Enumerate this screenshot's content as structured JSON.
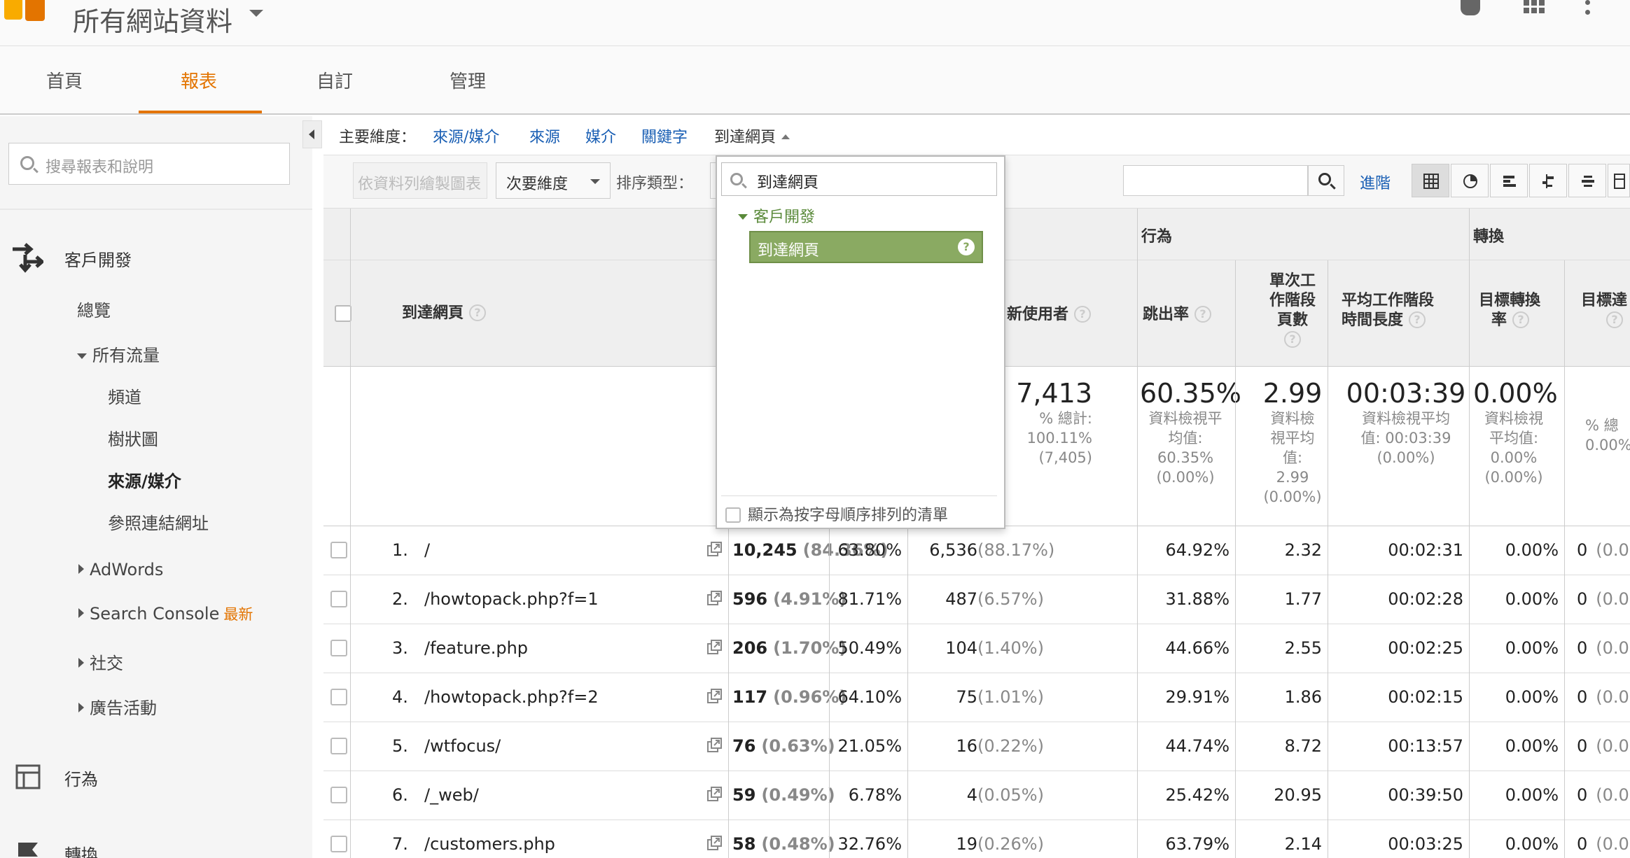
{
  "header": {
    "account": "所有網站資料"
  },
  "tabs": [
    {
      "label": "首頁"
    },
    {
      "label": "報表"
    },
    {
      "label": "自訂"
    },
    {
      "label": "管理"
    }
  ],
  "sidebar": {
    "search_placeholder": "搜尋報表和說明",
    "acquisition": "客戶開發",
    "overview": "總覽",
    "all_traffic": "所有流量",
    "channels": "頻道",
    "treemaps": "樹狀圖",
    "source_medium": "來源/媒介",
    "referrals": "參照連結網址",
    "adwords": "AdWords",
    "search_console": "Search Console",
    "new_badge": "最新",
    "social": "社交",
    "campaigns": "廣告活動",
    "behavior": "行為",
    "conversions": "轉換"
  },
  "dimension_bar": {
    "label": "主要維度：",
    "links": [
      "來源/媒介",
      "來源",
      "媒介",
      "關鍵字"
    ],
    "active": "到達網頁"
  },
  "toolbar": {
    "plot_rows": "依資料列繪製圖表",
    "secondary_dimension": "次要維度",
    "sort_type": "排序類型：",
    "advanced": "進階"
  },
  "dropdown": {
    "search_value": "到達網頁",
    "group": "客戶開發",
    "item": "到達網頁",
    "alphabetical": "顯示為按字母順序排列的清單"
  },
  "table": {
    "group_behavior": "行為",
    "group_conversion": "轉換",
    "col_landing_page": "到達網頁",
    "col_new_users": "新使用者",
    "col_bounce": "跳出率",
    "col_pages_l1": "單次工",
    "col_pages_l2": "作階段",
    "col_pages_l3": "頁數",
    "col_duration_l1": "平均工作階段",
    "col_duration_l2": "時間長度",
    "col_goal_rate_l1": "目標轉換",
    "col_goal_rate_l2": "率",
    "col_goal_comp": "目標達",
    "help": "?",
    "totals": {
      "new_users": "7,413",
      "new_users_sub": "% 總計:\n100.11%\n(7,405)",
      "bounce": "60.35%",
      "bounce_sub": "資料檢視平\n均值:\n60.35%\n(0.00%)",
      "pages": "2.99",
      "pages_sub": "資料檢\n視平均\n值:\n2.99\n(0.00%)",
      "duration": "00:03:39",
      "duration_sub": "資料檢視平均\n值: 00:03:39\n(0.00%)",
      "goal_rate": "0.00%",
      "goal_rate_sub": "資料檢視\n平均值:\n0.00%\n(0.00%)",
      "goal_comp_sub": "% 總\n0.00%"
    },
    "rows": [
      {
        "idx": "1.",
        "page": "/",
        "sessions": "10,245",
        "sessions_pct": "(84.36%)",
        "new_sessions": "63.80%",
        "new_users": "6,536",
        "new_users_pct": "(88.17%)",
        "bounce": "64.92%",
        "pages": "2.32",
        "duration": "00:02:31",
        "goal_rate": "0.00%",
        "goal_comp": "0",
        "goal_comp_pct": "(0.0"
      },
      {
        "idx": "2.",
        "page": "/howtopack.php?f=1",
        "sessions": "596",
        "sessions_pct": "(4.91%)",
        "new_sessions": "81.71%",
        "new_users": "487",
        "new_users_pct": "(6.57%)",
        "bounce": "31.88%",
        "pages": "1.77",
        "duration": "00:02:28",
        "goal_rate": "0.00%",
        "goal_comp": "0",
        "goal_comp_pct": "(0.0"
      },
      {
        "idx": "3.",
        "page": "/feature.php",
        "sessions": "206",
        "sessions_pct": "(1.70%)",
        "new_sessions": "50.49%",
        "new_users": "104",
        "new_users_pct": "(1.40%)",
        "bounce": "44.66%",
        "pages": "2.55",
        "duration": "00:02:25",
        "goal_rate": "0.00%",
        "goal_comp": "0",
        "goal_comp_pct": "(0.0"
      },
      {
        "idx": "4.",
        "page": "/howtopack.php?f=2",
        "sessions": "117",
        "sessions_pct": "(0.96%)",
        "new_sessions": "64.10%",
        "new_users": "75",
        "new_users_pct": "(1.01%)",
        "bounce": "29.91%",
        "pages": "1.86",
        "duration": "00:02:15",
        "goal_rate": "0.00%",
        "goal_comp": "0",
        "goal_comp_pct": "(0.0"
      },
      {
        "idx": "5.",
        "page": "/wtfocus/",
        "sessions": "76",
        "sessions_pct": "(0.63%)",
        "new_sessions": "21.05%",
        "new_users": "16",
        "new_users_pct": "(0.22%)",
        "bounce": "44.74%",
        "pages": "8.72",
        "duration": "00:13:57",
        "goal_rate": "0.00%",
        "goal_comp": "0",
        "goal_comp_pct": "(0.0"
      },
      {
        "idx": "6.",
        "page": "/_web/",
        "sessions": "59",
        "sessions_pct": "(0.49%)",
        "new_sessions": "6.78%",
        "new_users": "4",
        "new_users_pct": "(0.05%)",
        "bounce": "25.42%",
        "pages": "20.95",
        "duration": "00:39:50",
        "goal_rate": "0.00%",
        "goal_comp": "0",
        "goal_comp_pct": "(0.0"
      },
      {
        "idx": "7.",
        "page": "/customers.php",
        "sessions": "58",
        "sessions_pct": "(0.48%)",
        "new_sessions": "32.76%",
        "new_users": "19",
        "new_users_pct": "(0.26%)",
        "bounce": "63.79%",
        "pages": "2.14",
        "duration": "00:03:25",
        "goal_rate": "0.00%",
        "goal_comp": "0",
        "goal_comp_pct": "(0.0"
      }
    ]
  }
}
